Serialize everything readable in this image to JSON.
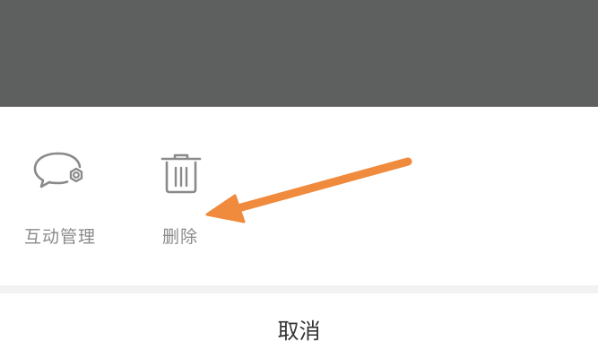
{
  "actions": {
    "interact_label": "互动管理",
    "delete_label": "删除"
  },
  "cancel_label": "取消",
  "colors": {
    "overlay": "#5e6060",
    "icon": "#8a8a8a",
    "annotation_arrow": "#f08a3c"
  },
  "icons": {
    "interact": "chat-bubble-gear-icon",
    "delete": "trash-can-icon"
  }
}
